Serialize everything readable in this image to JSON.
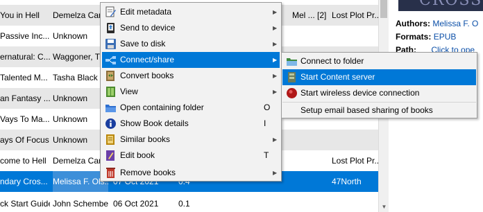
{
  "book_rows": [
    {
      "title": "You in Hell",
      "author": "Demelza Carl",
      "date": "",
      "size": "",
      "tags": "Mel ... [2]",
      "publisher": "Lost Plot Pr..."
    },
    {
      "title": "Passive Inc...",
      "author": "Unknown",
      "date": "",
      "size": "",
      "tags": "",
      "publisher": ""
    },
    {
      "title": "ernatural: C...",
      "author": "Waggoner, T",
      "date": "",
      "size": "",
      "tags": "",
      "publisher": ""
    },
    {
      "title": "Talented M...",
      "author": "Tasha Black",
      "date": "",
      "size": "",
      "tags": "",
      "publisher": ""
    },
    {
      "title": "an Fantasy ...",
      "author": "Unknown",
      "date": "",
      "size": "",
      "tags": "",
      "publisher": ""
    },
    {
      "title": "Vays To Ma...",
      "author": "Unknown",
      "date": "",
      "size": "",
      "tags": "",
      "publisher": ""
    },
    {
      "title": "ays Of Focus",
      "author": "Unknown",
      "date": "",
      "size": "",
      "tags": "",
      "publisher": ""
    },
    {
      "title": "come to Hell",
      "author": "Demelza Carl",
      "date": "",
      "size": "",
      "tags": "",
      "publisher": "Lost Plot Pr..."
    },
    {
      "title": "ndary Cros...",
      "author": "Melissa F. Ols...",
      "date": "07 Oct 2021",
      "size": "0.4",
      "tags": "",
      "publisher": "47North"
    },
    {
      "title": "ck Start Guide",
      "author": "John Schember",
      "date": "06 Oct 2021",
      "size": "0.1",
      "tags": "",
      "publisher": ""
    }
  ],
  "selected_row_index": 8,
  "details": {
    "cover_text": "CROSS",
    "authors_label": "Authors:",
    "authors_value": "Melissa F. O",
    "formats_label": "Formats:",
    "formats_value": "EPUB",
    "path_label": "Path:",
    "path_value": "Click to ope"
  },
  "context_menu": {
    "items": [
      {
        "label": "Edit metadata",
        "shortcut": "",
        "has_submenu": true,
        "icon": "edit-metadata-icon"
      },
      {
        "label": "Send to device",
        "shortcut": "",
        "has_submenu": true,
        "icon": "send-to-device-icon"
      },
      {
        "label": "Save to disk",
        "shortcut": "",
        "has_submenu": true,
        "icon": "save-to-disk-icon"
      },
      {
        "label": "Connect/share",
        "shortcut": "",
        "has_submenu": true,
        "icon": "connect-share-icon",
        "highlighted": true
      },
      {
        "label": "Convert books",
        "shortcut": "",
        "has_submenu": true,
        "icon": "convert-books-icon"
      },
      {
        "label": "View",
        "shortcut": "",
        "has_submenu": true,
        "icon": "view-icon"
      },
      {
        "label": "Open containing folder",
        "shortcut": "O",
        "has_submenu": false,
        "icon": "folder-icon"
      },
      {
        "label": "Show Book details",
        "shortcut": "I",
        "has_submenu": false,
        "icon": "info-icon"
      },
      {
        "label": "Similar books",
        "shortcut": "",
        "has_submenu": true,
        "icon": "similar-books-icon"
      },
      {
        "label": "Edit book",
        "shortcut": "T",
        "has_submenu": false,
        "icon": "edit-book-icon"
      },
      {
        "label": "Remove books",
        "shortcut": "",
        "has_submenu": true,
        "icon": "remove-books-icon"
      }
    ]
  },
  "submenu": {
    "items": [
      {
        "label": "Connect to folder",
        "icon": "connect-folder-icon"
      },
      {
        "label": "Start Content server",
        "icon": "content-server-icon",
        "highlighted": true
      },
      {
        "label": "Start wireless device connection",
        "icon": "wireless-device-icon"
      },
      {
        "label": "Setup email based sharing of books",
        "icon": ""
      }
    ]
  },
  "colors": {
    "selection": "#0078d7",
    "alt_row": "#e7e7e7",
    "menu_bg": "#f2f2f2",
    "link": "#0b4fa8"
  }
}
